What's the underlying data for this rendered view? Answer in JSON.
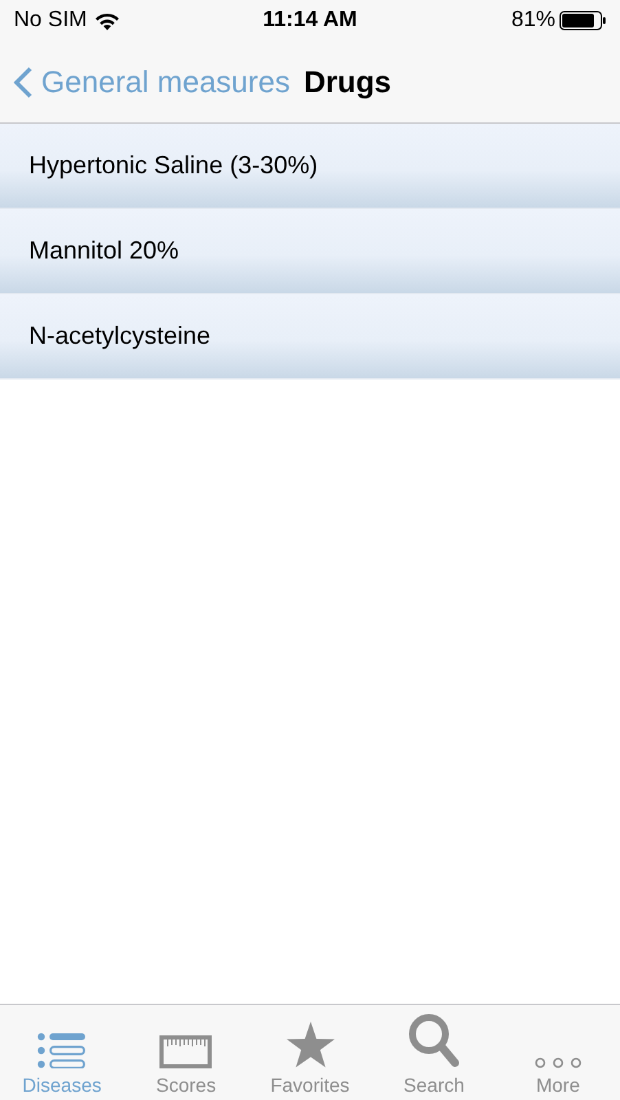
{
  "status_bar": {
    "carrier": "No SIM",
    "time": "11:14 AM",
    "battery": "81%"
  },
  "nav": {
    "back": "General measures",
    "title": "Drugs"
  },
  "items": [
    {
      "label": "Hypertonic Saline (3-30%)"
    },
    {
      "label": "Mannitol 20%"
    },
    {
      "label": "N-acetylcysteine"
    }
  ],
  "tabs": [
    {
      "label": "Diseases",
      "kind": "list",
      "selected": true
    },
    {
      "label": "Scores",
      "kind": "ruler",
      "selected": false
    },
    {
      "label": "Favorites",
      "kind": "star",
      "selected": false
    },
    {
      "label": "Search",
      "kind": "search",
      "selected": false
    },
    {
      "label": "More",
      "kind": "more",
      "selected": false
    }
  ]
}
